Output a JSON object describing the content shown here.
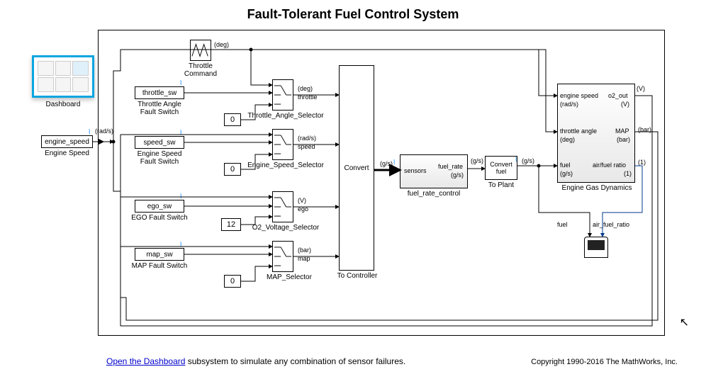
{
  "title": "Fault-Tolerant Fuel Control System",
  "footer": {
    "link_text": "Open the Dashboard",
    "link_suffix": " subsystem to simulate any combination of sensor failures.",
    "copyright": "Copyright 1990-2016 The MathWorks, Inc."
  },
  "dashboard": {
    "label": "Dashboard"
  },
  "engine_speed": {
    "block": "engine_speed",
    "label": "Engine Speed",
    "unit": "(rad/s)"
  },
  "throttle_command": {
    "label": "Throttle\nCommand",
    "unit": "(deg)"
  },
  "faults": {
    "throttle": {
      "block": "throttle_sw",
      "label": "Throttle Angle\nFault Switch"
    },
    "speed": {
      "block": "speed_sw",
      "label": "Engine Speed\nFault Switch"
    },
    "ego": {
      "block": "ego_sw",
      "label": "EGO Fault Switch"
    },
    "map": {
      "block": "map_sw",
      "label": "MAP Fault Switch"
    }
  },
  "consts": {
    "throttle": "0",
    "speed": "0",
    "ego": "12",
    "map": "0"
  },
  "selectors": {
    "throttle": {
      "label": "Throttle_Angle_Selector",
      "unit": "(deg)",
      "port": "throttle"
    },
    "speed": {
      "label": "Engine_Speed_Selector",
      "unit": "(rad/s)",
      "port": "speed"
    },
    "ego": {
      "label": "O2_Voltage_Selector",
      "unit": "(V)",
      "port": "ego"
    },
    "map": {
      "label": "MAP_Selector",
      "unit": "(bar)",
      "port": "map"
    }
  },
  "to_controller": {
    "label": "To Controller",
    "convert": "Convert"
  },
  "fuel_rate": {
    "label": "fuel_rate_control",
    "in": "sensors",
    "out": "fuel_rate",
    "out_unit": "(g/s)",
    "in_unit": "(g/s)"
  },
  "to_plant": {
    "label": "To Plant",
    "convert": "Convert",
    "port": "fuel",
    "unit": "(g/s)"
  },
  "engine_dyn": {
    "label": "Engine Gas Dynamics",
    "in1": "engine speed",
    "in1_unit": "(rad/s)",
    "in2": "throttle angle",
    "in2_unit": "(deg)",
    "in3": "fuel",
    "in3_unit": "(g/s)",
    "out1": "o2_out",
    "out1_unit": "(V)",
    "out2": "MAP",
    "out2_unit": "(bar)",
    "out3": "air/fuel ratio",
    "out3_unit": "(1)",
    "top_unit": "(V)",
    "mid_unit": "(bar)",
    "bot_unit": "(1)"
  },
  "scope": {
    "in1": "fuel",
    "in2": "air_fuel_ratio"
  }
}
